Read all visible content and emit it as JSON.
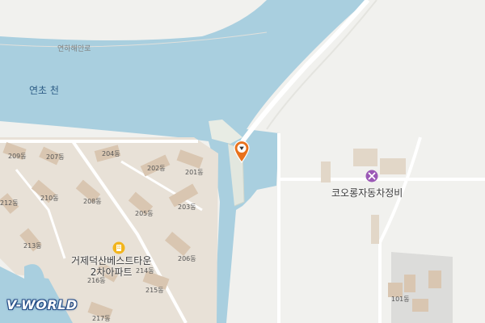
{
  "map": {
    "road_label": "연하해안로",
    "river_label": "연초 천",
    "poi_label": "코오롱자동차정비",
    "poi_icon": "wrench-icon",
    "apartment_label_line1": "거제덕산베스트타운",
    "apartment_label_line2": "2차아파트",
    "apartment_icon": "apartment-icon",
    "marker_icon": "location-pin-icon",
    "buildings": [
      "209동",
      "207동",
      "204동",
      "202동",
      "201동",
      "210동",
      "208동",
      "205동",
      "203동",
      "212동",
      "213동",
      "206동",
      "214동",
      "216동",
      "215동",
      "217동",
      "101동"
    ],
    "logo": "V-WORLD",
    "colors": {
      "water": "#a9cfdf",
      "land": "#f1f1ee",
      "block": "#e8e1d7",
      "building": "#d9c6b1",
      "marker": "#e8711c",
      "poi": "#9b59b6",
      "apt_icon": "#f2b51d",
      "logo_outline": "#234a85"
    }
  }
}
